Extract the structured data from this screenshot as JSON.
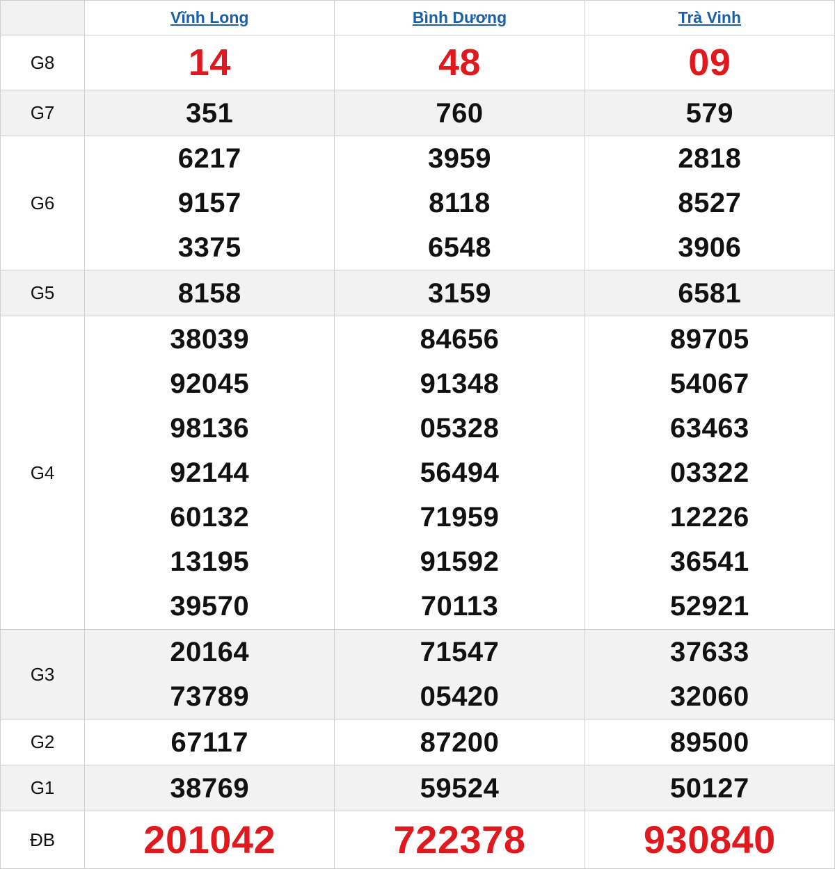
{
  "provinces": [
    "Vĩnh Long",
    "Bình Dương",
    "Trà Vinh"
  ],
  "prizes": [
    {
      "label": "G8",
      "values": [
        [
          "14"
        ],
        [
          "48"
        ],
        [
          "09"
        ]
      ]
    },
    {
      "label": "G7",
      "values": [
        [
          "351"
        ],
        [
          "760"
        ],
        [
          "579"
        ]
      ]
    },
    {
      "label": "G6",
      "values": [
        [
          "6217",
          "9157",
          "3375"
        ],
        [
          "3959",
          "8118",
          "6548"
        ],
        [
          "2818",
          "8527",
          "3906"
        ]
      ]
    },
    {
      "label": "G5",
      "values": [
        [
          "8158"
        ],
        [
          "3159"
        ],
        [
          "6581"
        ]
      ]
    },
    {
      "label": "G4",
      "values": [
        [
          "38039",
          "92045",
          "98136",
          "92144",
          "60132",
          "13195",
          "39570"
        ],
        [
          "84656",
          "91348",
          "05328",
          "56494",
          "71959",
          "91592",
          "70113"
        ],
        [
          "89705",
          "54067",
          "63463",
          "03322",
          "12226",
          "36541",
          "52921"
        ]
      ]
    },
    {
      "label": "G3",
      "values": [
        [
          "20164",
          "73789"
        ],
        [
          "71547",
          "05420"
        ],
        [
          "37633",
          "32060"
        ]
      ]
    },
    {
      "label": "G2",
      "values": [
        [
          "67117"
        ],
        [
          "87200"
        ],
        [
          "89500"
        ]
      ]
    },
    {
      "label": "G1",
      "values": [
        [
          "38769"
        ],
        [
          "59524"
        ],
        [
          "50127"
        ]
      ]
    },
    {
      "label": "ĐB",
      "values": [
        [
          "201042"
        ],
        [
          "722378"
        ],
        [
          "930840"
        ]
      ]
    }
  ],
  "colors": {
    "accent_red": "#e0191f",
    "link_blue": "#1a5fa8",
    "row_shade": "#f2f2f2",
    "border": "#cfcfcf"
  }
}
